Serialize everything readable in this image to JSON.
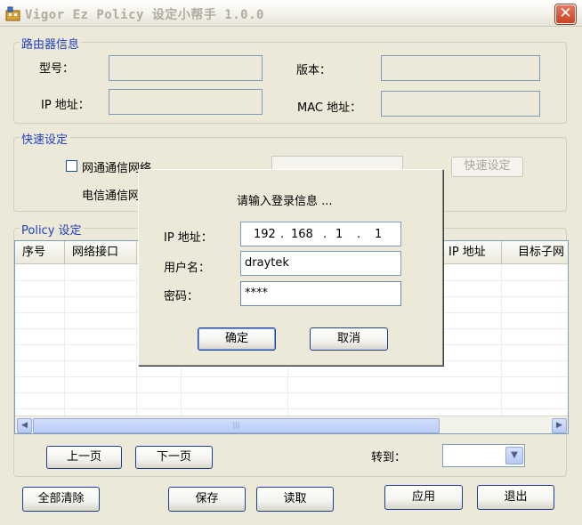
{
  "window": {
    "title": "Vigor Ez Policy 设定小帮手 1.0.0",
    "close_glyph": "✕"
  },
  "router_info": {
    "group_label": "路由器信息",
    "model_label": "型号：",
    "version_label": "版本：",
    "ip_label": "IP 地址：",
    "mac_label": "MAC 地址："
  },
  "quick_setup": {
    "group_label": "快速设定",
    "checkbox_label": "网通通信网络",
    "telecom_label": "电信通信网络",
    "quick_button": "快速设定"
  },
  "policy": {
    "group_label": "Policy 设定",
    "columns": [
      "序号",
      "网络接口",
      "",
      "",
      "IP 地址",
      "目标子网"
    ]
  },
  "nav": {
    "prev": "上一页",
    "next": "下一页",
    "goto_label": "转到：",
    "goto_value": ""
  },
  "actions": {
    "clear_all": "全部清除",
    "save": "保存",
    "load": "读取",
    "apply": "应用",
    "exit": "退出"
  },
  "login_dialog": {
    "heading": "请输入登录信息 ...",
    "ip_label": "IP 地址：",
    "ip_octets": [
      "192",
      "168",
      "1",
      "1"
    ],
    "username_label": "用户名：",
    "username_value": "draytek",
    "password_label": "密码：",
    "password_value": "****",
    "ok_button": "确定",
    "cancel_button": "取消"
  },
  "scrollbar": {
    "left_glyph": "◀",
    "right_glyph": "▶",
    "thumb_grip": "|||",
    "combo_glyph": "▼"
  }
}
